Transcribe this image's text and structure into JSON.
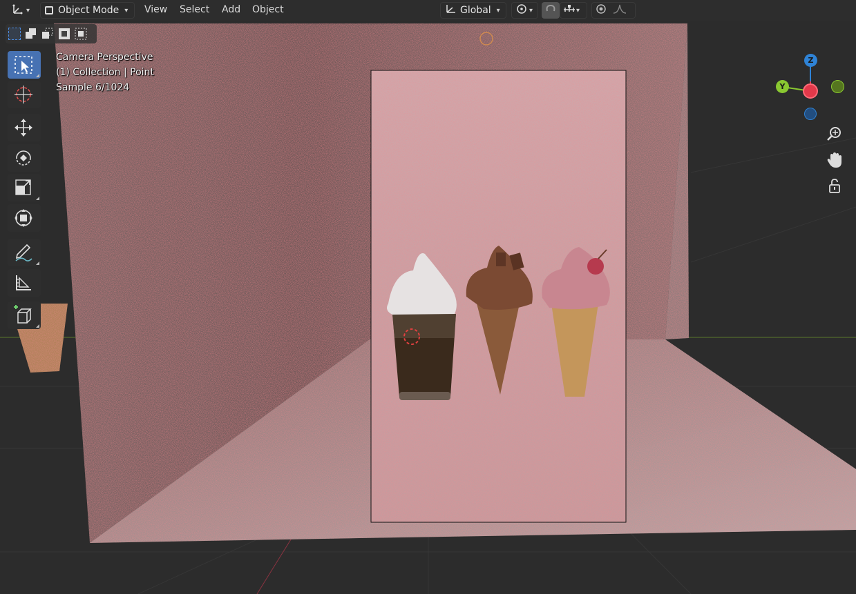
{
  "header": {
    "editor_type_icon": "axis-gizmo-icon",
    "mode": "Object Mode",
    "menus": [
      "View",
      "Select",
      "Add",
      "Object"
    ],
    "transform_orientation": "Global"
  },
  "overlay": {
    "view_name": "Camera Perspective",
    "collection_info": "(1) Collection | Point",
    "sample": "Sample 6/1024"
  },
  "gizmo": {
    "z_label": "Z",
    "y_label": "Y",
    "colors": {
      "x": "#e3394a",
      "y": "#8ac831",
      "z": "#2f83d6"
    }
  },
  "toolbar": {
    "tools": [
      "select-box-icon",
      "cursor-icon",
      "move-icon",
      "rotate-icon",
      "scale-icon",
      "transform-icon",
      "annotate-icon",
      "measure-icon",
      "add-cube-icon"
    ]
  },
  "navigation": [
    "zoom-icon",
    "pan-hand-icon",
    "lock-icon"
  ],
  "colors": {
    "accent": "#4772b3",
    "header_bg": "#303030",
    "viewport_bg": "#2b2b2b"
  }
}
